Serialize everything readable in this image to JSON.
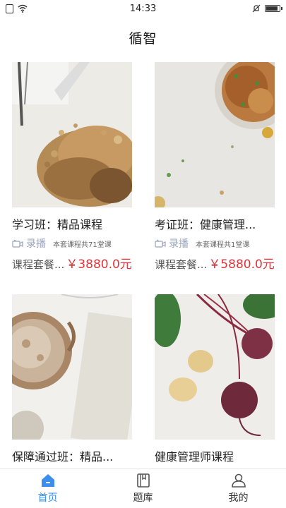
{
  "status_bar": {
    "time": "14:33"
  },
  "header": {
    "title": "循智"
  },
  "courses": [
    {
      "title": "学习班：精品课程",
      "type": "录播",
      "lesson_count": "本套课程共71堂课",
      "price_label": "课程套餐...",
      "price": "￥3880.0元",
      "image": "nuts-photo"
    },
    {
      "title": "考证班：健康管理...",
      "type": "录播",
      "lesson_count": "本套课程共1堂课",
      "price_label": "课程套餐...",
      "price": "￥5880.0元",
      "image": "salad-bowl-photo"
    },
    {
      "title": "保障通过班：精品...",
      "image": "coffee-notebook-photo"
    },
    {
      "title": "健康管理师课程",
      "image": "beets-potatoes-photo"
    }
  ],
  "tab_bar": {
    "items": [
      {
        "label": "首页",
        "icon": "home-icon",
        "active": true
      },
      {
        "label": "题库",
        "icon": "book-icon",
        "active": false
      },
      {
        "label": "我的",
        "icon": "user-icon",
        "active": false
      }
    ]
  },
  "colors": {
    "accent": "#3b8df0",
    "price": "#e0333a",
    "meta": "#9aa3bc"
  }
}
